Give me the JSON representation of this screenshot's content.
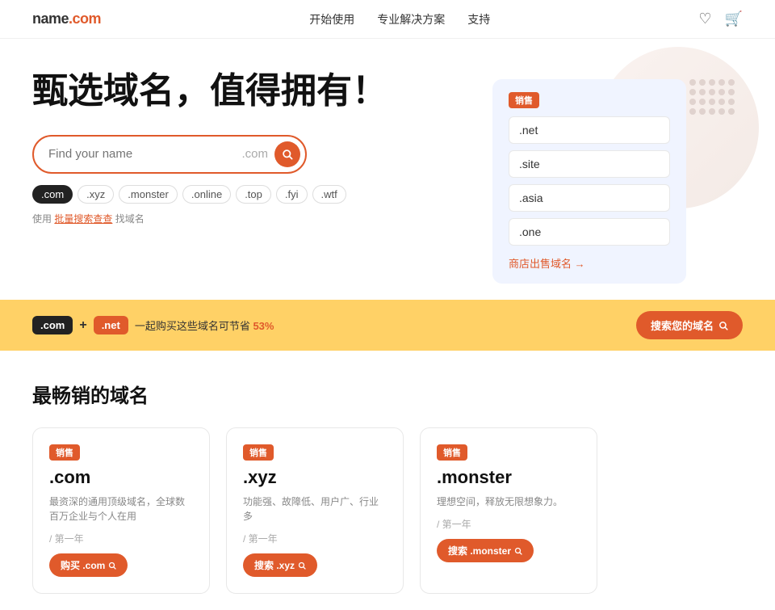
{
  "header": {
    "logo": "name.com",
    "nav": [
      {
        "label": "开始使用",
        "id": "nav-start"
      },
      {
        "label": "专业解决方案",
        "id": "nav-solutions"
      },
      {
        "label": "支持",
        "id": "nav-support"
      }
    ],
    "icons": [
      "heart",
      "cart"
    ]
  },
  "hero": {
    "title": "甄选域名，值得拥有！",
    "search": {
      "placeholder": "Find your name",
      "suffix": ".com",
      "button_label": "🔍"
    },
    "tld_tags": [
      {
        "label": ".com",
        "active": true
      },
      {
        "label": ".xyz",
        "active": false
      },
      {
        "label": ".monster",
        "active": false
      },
      {
        "label": ".online",
        "active": false
      },
      {
        "label": ".top",
        "active": false
      },
      {
        "label": ".fyi",
        "active": false
      },
      {
        "label": ".wtf",
        "active": false
      }
    ],
    "bulk_label": "使用",
    "bulk_link": "批量搜索查查",
    "bulk_suffix": "找域名"
  },
  "domain_card": {
    "badge": "销售",
    "items": [
      ".net",
      ".site",
      ".asia",
      ".one"
    ],
    "shop_link": "商店出售域名 →"
  },
  "promo_banner": {
    "badge1": ".com",
    "plus": "+",
    "badge2": ".net",
    "text": "一起购买这些域名可节省",
    "highlight": "53%",
    "button_label": "搜索您的域名",
    "button_arrow": "🔍"
  },
  "bestsellers": {
    "section_title": "最畅销的域名",
    "cards": [
      {
        "badge": "销售",
        "ext": ".com",
        "desc": "最资深的通用顶级域名，全球数百万企业与个人在用",
        "price_label": "/ 第一年",
        "btn_label": "购买 .com"
      },
      {
        "badge": "销售",
        "ext": ".xyz",
        "desc": "功能强、故障低、用户广、行业多",
        "price_label": "/ 第一年",
        "btn_label": "搜索 .xyz"
      },
      {
        "badge": "销售",
        "ext": ".monster",
        "desc": "理想空间，释放无限想象力。",
        "price_label": "/ 第一年",
        "btn_label": "搜索 .monster"
      }
    ]
  }
}
